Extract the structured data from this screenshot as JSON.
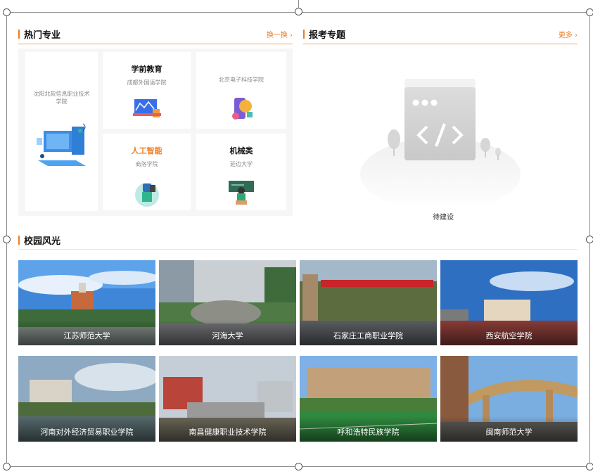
{
  "hot_majors": {
    "title": "热门专业",
    "more": "换一换 ›",
    "featured": {
      "subtitle": "沈阳北软信息职业技术学院"
    },
    "cards": [
      {
        "name": "学前教育",
        "school": "成都外国语学院"
      },
      {
        "name": "",
        "school": "北京电子科技学院"
      },
      {
        "name": "人工智能",
        "school": "商洛学院"
      },
      {
        "name": "机械类",
        "school": "延边大学"
      }
    ]
  },
  "topics": {
    "title": "报考专题",
    "more": "更多 ›",
    "empty_text": "待建设"
  },
  "campus": {
    "title": "校园风光",
    "photos": [
      {
        "caption": "江苏师范大学"
      },
      {
        "caption": "河海大学"
      },
      {
        "caption": "石家庄工商职业学院"
      },
      {
        "caption": "西安航空学院"
      },
      {
        "caption": "河南对外经济贸易职业学院"
      },
      {
        "caption": "南昌健康职业技术学院"
      },
      {
        "caption": "呼和浩特民族学院"
      },
      {
        "caption": "闽南师范大学"
      }
    ]
  },
  "colors": {
    "accent": "#f07c1c"
  }
}
